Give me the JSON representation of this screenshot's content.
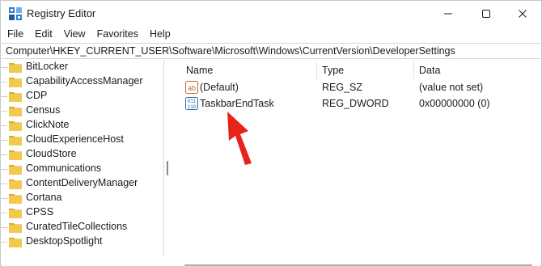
{
  "window": {
    "title": "Registry Editor",
    "controls": {
      "minimize": "minimize-icon",
      "maximize": "maximize-icon",
      "close": "close-icon"
    }
  },
  "menu": [
    "File",
    "Edit",
    "View",
    "Favorites",
    "Help"
  ],
  "address": "Computer\\HKEY_CURRENT_USER\\Software\\Microsoft\\Windows\\CurrentVersion\\DeveloperSettings",
  "tree": {
    "items": [
      "BitLocker",
      "CapabilityAccessManager",
      "CDP",
      "Census",
      "ClickNote",
      "CloudExperienceHost",
      "CloudStore",
      "Communications",
      "ContentDeliveryManager",
      "Cortana",
      "CPSS",
      "CuratedTileCollections",
      "DesktopSpotlight"
    ]
  },
  "values": {
    "columns": {
      "name": "Name",
      "type": "Type",
      "data": "Data"
    },
    "rows": [
      {
        "name": "(Default)",
        "type": "REG_SZ",
        "data": "(value not set)",
        "icon": "string-value-icon"
      },
      {
        "name": "TaskbarEndTask",
        "type": "REG_DWORD",
        "data": "0x00000000 (0)",
        "icon": "dword-value-icon"
      }
    ]
  },
  "colors": {
    "folder": "#f2c94c",
    "folder_dark": "#e0a82e",
    "annotation_arrow": "#e8231c",
    "accent": "#0067c0"
  }
}
